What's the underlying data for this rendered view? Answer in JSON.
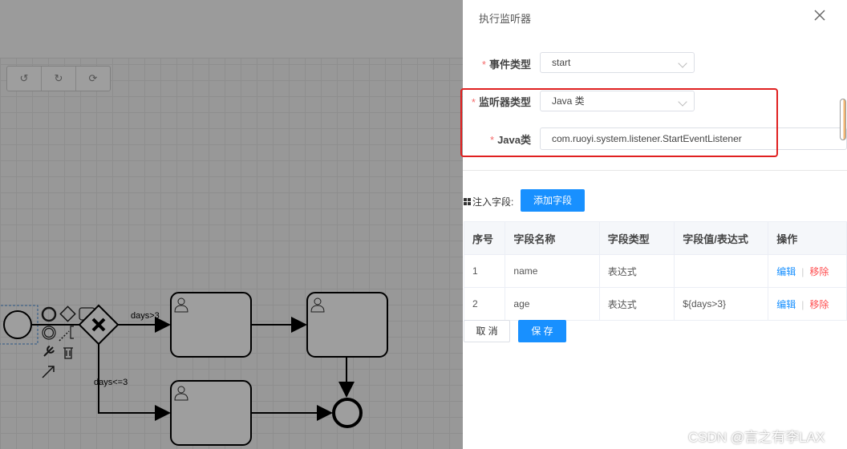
{
  "diagram": {
    "gateway_label_top": "days>3",
    "gateway_label_bottom": "days<=3"
  },
  "drawer": {
    "title": "执行监听器",
    "event_type": {
      "label": "事件类型",
      "value": "start"
    },
    "listener_type": {
      "label": "监听器类型",
      "value": "Java 类"
    },
    "java_class": {
      "label": "Java类",
      "value": "com.ruoyi.system.listener.StartEventListener"
    },
    "inject": {
      "label": "注入字段:",
      "add_button": "添加字段"
    },
    "table": {
      "headers": [
        "序号",
        "字段名称",
        "字段类型",
        "字段值/表达式",
        "操作"
      ],
      "rows": [
        {
          "index": "1",
          "name": "name",
          "type": "表达式",
          "value": ""
        },
        {
          "index": "2",
          "name": "age",
          "type": "表达式",
          "value": "${days>3}"
        }
      ],
      "edit": "编辑",
      "remove": "移除"
    },
    "cancel": "取 消",
    "save": "保 存"
  },
  "watermark": "CSDN @言之有李LAX",
  "colors": {
    "primary": "#1890ff",
    "danger": "#ff4d4f",
    "required": "#f56c6c",
    "highlight": "#e02020"
  }
}
